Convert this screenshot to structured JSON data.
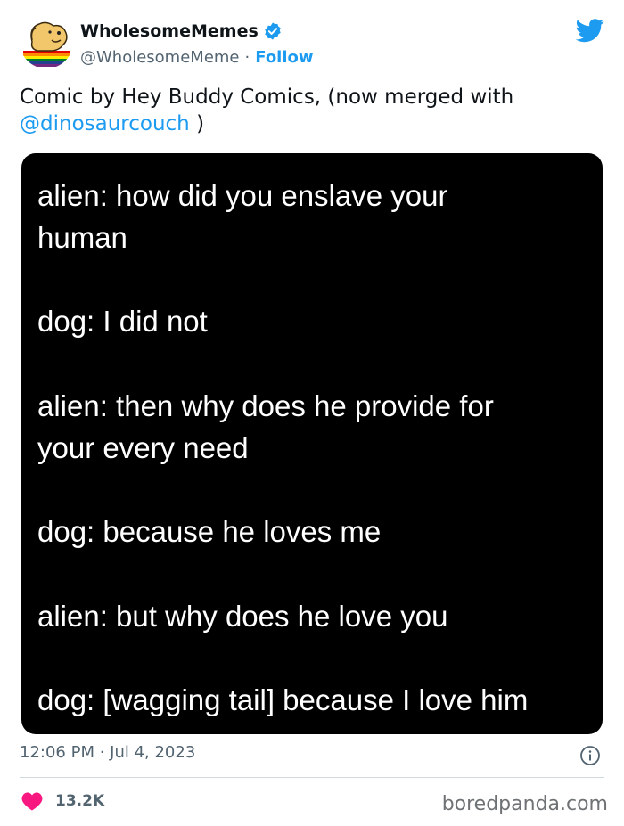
{
  "user": {
    "display_name": "WholesomeMemes",
    "handle": "@WholesomeMeme",
    "separator": "·",
    "follow_label": "Follow"
  },
  "tweet": {
    "text_prefix": "Comic by Hey Buddy Comics, (now merged with",
    "mention": "@dinosaurcouch",
    "text_suffix": " )"
  },
  "comic": {
    "lines": [
      "alien: how did you enslave your",
      "human",
      "dog: I did not",
      "alien: then why does he provide for",
      "your every need",
      "dog: because he loves me",
      "alien: but why does he love you",
      "dog: [wagging tail] because I love him"
    ]
  },
  "footer": {
    "timestamp": "12:06 PM · Jul 4, 2023",
    "like_count": "13.2K",
    "watermark": "boredpanda.com"
  },
  "colors": {
    "accent": "#1d9bf0",
    "heart": "#f91880",
    "muted": "#536471"
  },
  "icons": [
    "avatar-dog",
    "verified-badge-icon",
    "twitter-bird-icon",
    "info-icon",
    "heart-icon"
  ]
}
